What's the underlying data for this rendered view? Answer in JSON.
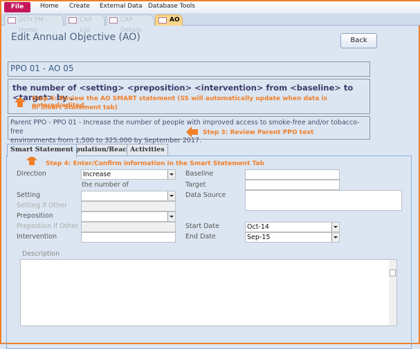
{
  "ribbon": {
    "tabs": [
      "File",
      "Home",
      "Create",
      "External Data",
      "Database Tools"
    ]
  },
  "doc_tabs": [
    "DCH PM - Home",
    "CAP List",
    "CAP Details",
    "AO"
  ],
  "form": {
    "title": "Edit Annual Objective (AO)",
    "back_label": "Back",
    "ppo_ao": "PPO 01 - AO 05",
    "smart_statement": "the number of <setting> <preposition> <intervention> from <baseline> to <target> by .",
    "step5": "Step 5: Review the AO SMART statement (SS will automatically update when data is entered/edited",
    "step5b": "in Smart Statement tab)",
    "parent_line1": "Parent PPO - PPO 01 - Increase the number of people with improved access to smoke-free and/or tobacco-free",
    "parent_line2": "environments from 1,500 to 325,000 by September 2017.",
    "step3": "Step 3: Review Parent PPO text",
    "tabs": [
      "Smart Statement",
      "Population/Reach",
      "Activities"
    ],
    "step4": "Step 4: Enter/Confirm information in the Smart Statement Tab",
    "fields": {
      "direction_label": "Direction",
      "direction_value": "Increase",
      "the_number_of": "the number of",
      "setting_label": "Setting",
      "setting_value": "",
      "setting_other_label": "Setting if Other",
      "preposition_label": "Preposition",
      "preposition_value": "",
      "preposition_other_label": "Prepostion if Other",
      "intervention_label": "Intervention",
      "intervention_value": "",
      "baseline_label": "Baseline",
      "baseline_value": "",
      "target_label": "Target",
      "target_value": "",
      "data_source_label": "Data Source",
      "data_source_value": "",
      "start_date_label": "Start Date",
      "start_date_value": "Oct-14",
      "end_date_label": "End Date",
      "end_date_value": "Sep-15",
      "description_label": "Description",
      "description_value": ""
    }
  },
  "colors": {
    "accent": "#f07f2a",
    "file_tab": "#c4175a",
    "background": "#dce6f2"
  }
}
